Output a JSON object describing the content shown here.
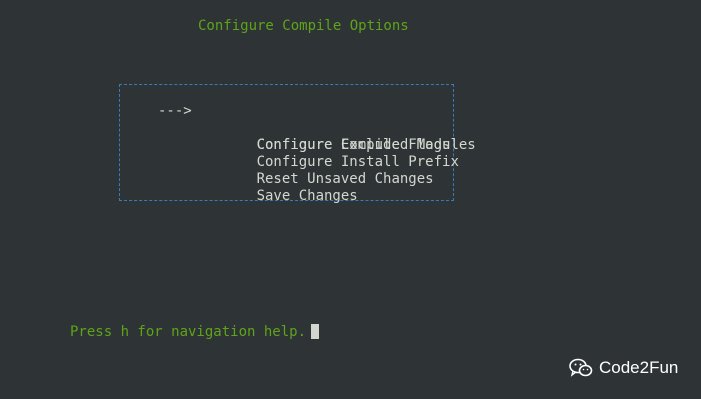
{
  "screen": {
    "title": "Configure Compile Options",
    "background": "#2e3436",
    "title_color": "#5fa319",
    "border_color": "#3b79b8"
  },
  "menu": {
    "selection_marker": "--->",
    "selected_index": 0,
    "items": [
      {
        "label": "Configure Compile Flags"
      },
      {
        "label": "Configure Excluded Modules"
      },
      {
        "label": "Configure Install Prefix"
      },
      {
        "label": "Reset Unsaved Changes"
      },
      {
        "label": "Save Changes"
      }
    ]
  },
  "footer": {
    "help_text": "Press h for navigation help."
  },
  "watermark": {
    "icon": "wechat-icon",
    "text": "Code2Fun"
  }
}
